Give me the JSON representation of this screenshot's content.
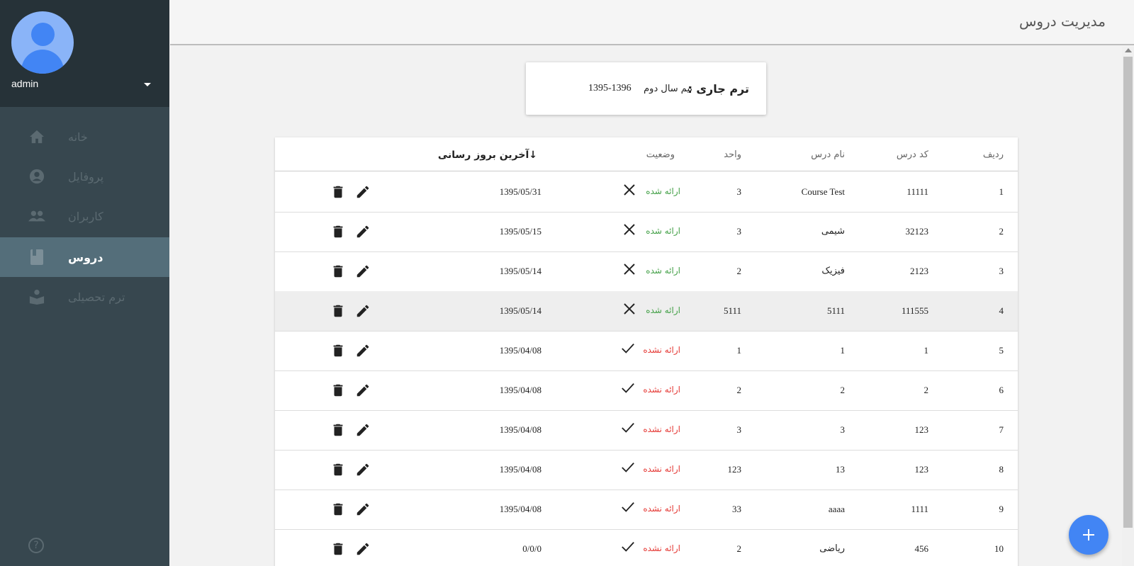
{
  "sidebar": {
    "username": "admin",
    "items": [
      {
        "label": "خانه",
        "icon": "home-icon",
        "active": false
      },
      {
        "label": "پروفایل",
        "icon": "account-circle-icon",
        "active": false
      },
      {
        "label": "کاربران",
        "icon": "people-icon",
        "active": false
      },
      {
        "label": "دروس",
        "icon": "book-icon",
        "active": true
      },
      {
        "label": "ترم تحصیلی",
        "icon": "school-book-icon",
        "active": false
      }
    ],
    "help_icon": "?"
  },
  "header": {
    "title": "مدیریت دروس"
  },
  "term": {
    "label": "ترم جاری :",
    "value": "نیم سال دوم",
    "years": "1395-1396"
  },
  "table": {
    "columns": {
      "row": "ردیف",
      "code": "کد درس",
      "name": "نام درس",
      "units": "واحد",
      "status": "وضعیت",
      "updated": "آخرین بروز رسانی",
      "sort_arrow": "↓"
    },
    "rows": [
      {
        "row": "1",
        "code": "11111",
        "name": "Course Test",
        "units": "3",
        "status": "ارائه شده",
        "offered": true,
        "updated": "1395/05/31"
      },
      {
        "row": "2",
        "code": "32123",
        "name": "شیمی",
        "units": "3",
        "status": "ارائه شده",
        "offered": true,
        "updated": "1395/05/15"
      },
      {
        "row": "3",
        "code": "2123",
        "name": "فیزیک",
        "units": "2",
        "status": "ارائه شده",
        "offered": true,
        "updated": "1395/05/14"
      },
      {
        "row": "4",
        "code": "111555",
        "name": "5111",
        "units": "5111",
        "status": "ارائه شده",
        "offered": true,
        "updated": "1395/05/14"
      },
      {
        "row": "5",
        "code": "1",
        "name": "1",
        "units": "1",
        "status": "ارائه نشده",
        "offered": false,
        "updated": "1395/04/08"
      },
      {
        "row": "6",
        "code": "2",
        "name": "2",
        "units": "2",
        "status": "ارائه نشده",
        "offered": false,
        "updated": "1395/04/08"
      },
      {
        "row": "7",
        "code": "123",
        "name": "3",
        "units": "3",
        "status": "ارائه نشده",
        "offered": false,
        "updated": "1395/04/08"
      },
      {
        "row": "8",
        "code": "123",
        "name": "13",
        "units": "123",
        "status": "ارائه نشده",
        "offered": false,
        "updated": "1395/04/08"
      },
      {
        "row": "9",
        "code": "1111",
        "name": "aaaa",
        "units": "33",
        "status": "ارائه نشده",
        "offered": false,
        "updated": "1395/04/08"
      },
      {
        "row": "10",
        "code": "456",
        "name": "ریاضی",
        "units": "2",
        "status": "ارائه نشده",
        "offered": false,
        "updated": "0/0/0"
      }
    ]
  },
  "fab": {
    "label": "+"
  },
  "colors": {
    "sidebar": "#37474f",
    "profile": "#263238",
    "active": "#546e7a",
    "offered": "#43a047",
    "not_offered": "#e53935",
    "accent": "#4285f4"
  }
}
